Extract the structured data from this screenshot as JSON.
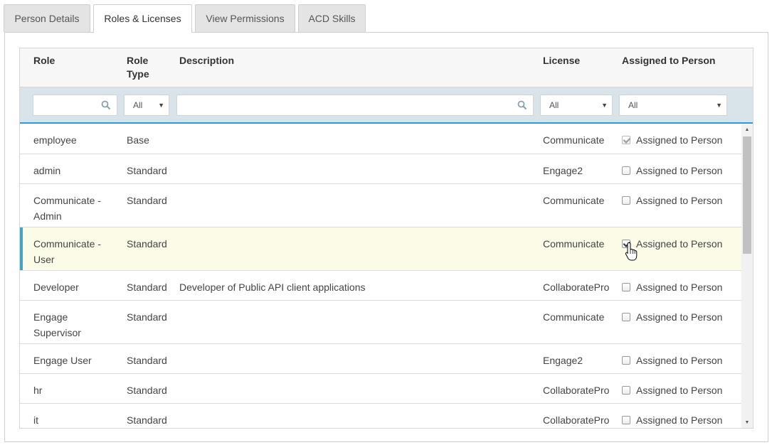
{
  "tabs": [
    {
      "label": "Person Details",
      "active": false
    },
    {
      "label": "Roles & Licenses",
      "active": true
    },
    {
      "label": "View Permissions",
      "active": false
    },
    {
      "label": "ACD Skills",
      "active": false
    }
  ],
  "grid": {
    "columns": {
      "role": "Role",
      "role_type": "Role\nType",
      "description": "Description",
      "license": "License",
      "assigned": "Assigned to Person"
    },
    "filters": {
      "role_search": "",
      "role_type": "All",
      "description_search": "",
      "license": "All",
      "assigned": "All"
    },
    "rows": [
      {
        "role": "employee",
        "type": "Base",
        "description": "",
        "license": "Communicate",
        "assigned_label": "Assigned to Person",
        "checked": true,
        "disabled": true
      },
      {
        "role": "admin",
        "type": "Standard",
        "description": "",
        "license": "Engage2",
        "assigned_label": "Assigned to Person",
        "checked": false
      },
      {
        "role": "Communicate - Admin",
        "type": "Standard",
        "description": "",
        "license": "Communicate",
        "assigned_label": "Assigned to Person",
        "checked": false
      },
      {
        "role": "Communicate - User",
        "type": "Standard",
        "description": "",
        "license": "Communicate",
        "assigned_label": "Assigned to Person",
        "checked": true
      },
      {
        "role": "Developer",
        "type": "Standard",
        "description": "Developer of Public API client applications",
        "license": "CollaboratePro",
        "assigned_label": "Assigned to Person",
        "checked": false
      },
      {
        "role": "Engage Supervisor",
        "type": "Standard",
        "description": "",
        "license": "Communicate",
        "assigned_label": "Assigned to Person",
        "checked": false
      },
      {
        "role": "Engage User",
        "type": "Standard",
        "description": "",
        "license": "Engage2",
        "assigned_label": "Assigned to Person",
        "checked": false
      },
      {
        "role": "hr",
        "type": "Standard",
        "description": "",
        "license": "CollaboratePro",
        "assigned_label": "Assigned to Person",
        "checked": false
      },
      {
        "role": "it",
        "type": "Standard",
        "description": "",
        "license": "CollaboratePro",
        "assigned_label": "Assigned to Person",
        "checked": false
      }
    ]
  },
  "icons": {
    "search": "search-icon",
    "dropdown": "caret-down-icon",
    "cursor": "hand-pointer-icon"
  },
  "colors": {
    "accent": "#2d9bd0",
    "row_highlight": "#fbfbe7",
    "filter_bg": "#d9e4ea"
  }
}
